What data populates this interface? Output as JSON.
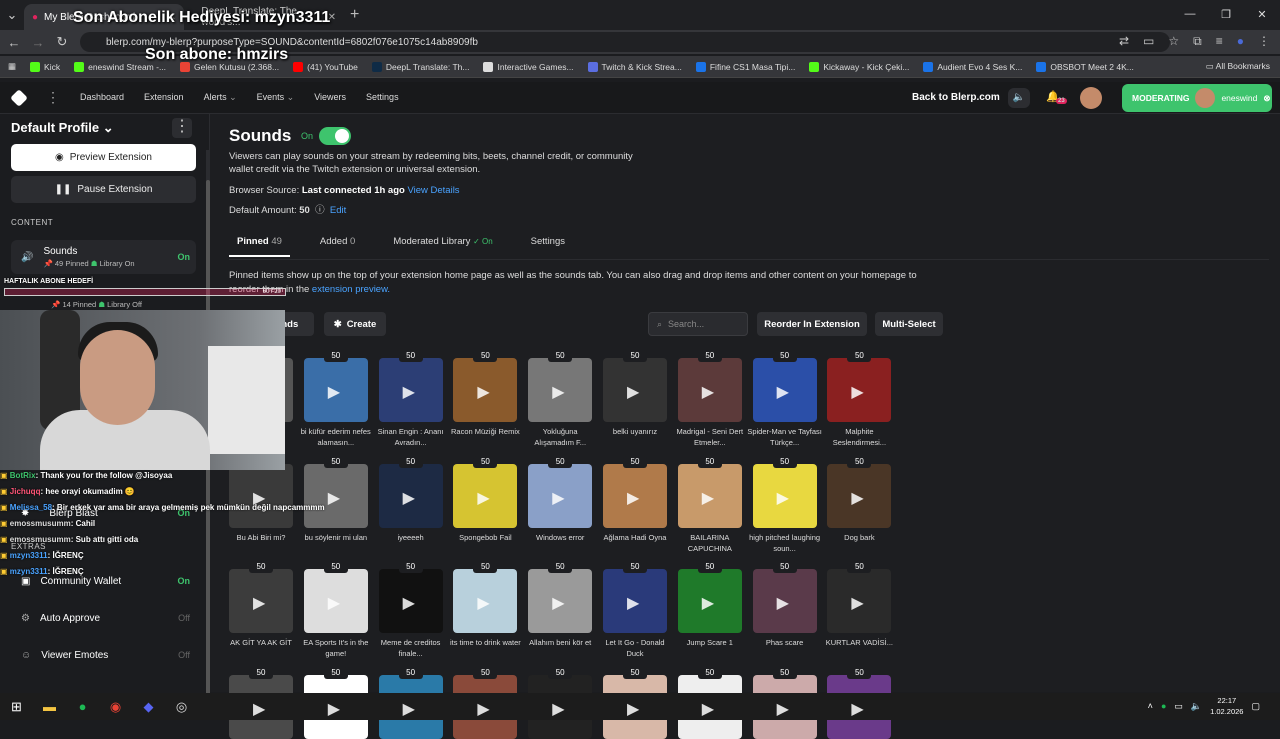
{
  "browser": {
    "tabs": [
      {
        "label": "My Blerp Dashboard",
        "active": true
      },
      {
        "label": "DeepL Translate: The world's...",
        "active": false
      }
    ],
    "url": "blerp.com/my-blerp?purposeType=SOUND&contentId=6802f076e1075c14ab8909fb",
    "bookmarks": [
      "Kick",
      "eneswind Stream -...",
      "Gelen Kutusu (2.368...",
      "(41) YouTube",
      "DeepL Translate: Th...",
      "Interactive Games...",
      "Twitch & Kick Strea...",
      "Fifine CS1 Masa Tipi...",
      "Kickaway - Kick Çeki...",
      "Audient Evo 4 Ses K...",
      "OBSBOT Meet 2 4K..."
    ],
    "bookmarks_right": "All Bookmarks"
  },
  "overlay": {
    "line1": "Son Abonelik Hediyesi: mzyn3311",
    "line2": "Son abone: hmzirs",
    "goal_title": "HAFTALIK ABONE HEDEFİ",
    "goal_value": "60 / 20",
    "chat": [
      {
        "user": "BotRix",
        "msg": ": Thank you for the follow @Jisoyaa",
        "color": "#3ec46d"
      },
      {
        "user": "Jichuqq",
        "msg": ": hee orayi okumadim 😊",
        "color": "#ff5577"
      },
      {
        "user": "Melissa_58",
        "msg": ": Bir erkek var ama bir araya gelmemiş pek mümkün değil napcammmm",
        "color": "#4aa3ff"
      },
      {
        "user": "emossmusumm",
        "msg": ": Cahil",
        "color": "#ddd"
      },
      {
        "user": "emossmusumm",
        "msg": ": Sub attı gitti oda",
        "color": "#ddd"
      },
      {
        "user": "mzyn3311",
        "msg": ": İĞRENÇ",
        "color": "#4aa3ff"
      },
      {
        "user": "mzyn3311",
        "msg": ": İĞRENÇ",
        "color": "#4aa3ff"
      }
    ]
  },
  "nav": {
    "links": [
      "Dashboard",
      "Extension",
      "Alerts",
      "Events",
      "Viewers",
      "Settings"
    ],
    "back": "Back to Blerp.com",
    "notif_count": "23",
    "moderating": "MODERATING",
    "mod_user": "eneswind"
  },
  "sidebar": {
    "profile": "Default Profile",
    "preview": "Preview Extension",
    "pause": "Pause Extension",
    "content_label": "CONTENT",
    "sounds": {
      "label": "Sounds",
      "sub1": "49 Pinned",
      "sub2": "Library On",
      "status": "On"
    },
    "second": {
      "sub1": "14 Pinned",
      "sub2": "Library Off"
    },
    "blast": {
      "label": "Blerp Blast",
      "status": "On"
    },
    "extras_label": "EXTRAS",
    "community": {
      "label": "Community Wallet",
      "status": "On"
    },
    "auto": {
      "label": "Auto Approve",
      "status": "Off"
    },
    "emotes": {
      "label": "Viewer Emotes",
      "status": "Off"
    }
  },
  "main": {
    "title": "Sounds",
    "on_label": "On",
    "desc": "Viewers can play sounds on your stream by redeeming bits, beets, channel credit, or community wallet credit via the Twitch extension or universal extension.",
    "browser_source_label": "Browser Source:",
    "browser_source_value": "Last connected 1h ago",
    "view_details": "View Details",
    "default_amount_label": "Default Amount:",
    "default_amount_value": "50",
    "edit": "Edit",
    "tabs": [
      {
        "label": "Pinned",
        "count": "49"
      },
      {
        "label": "Added",
        "count": "0"
      },
      {
        "label": "Moderated Library",
        "count": "✓ On"
      },
      {
        "label": "Settings",
        "count": ""
      }
    ],
    "pinned_desc": "Pinned items show up on the top of your extension home page as well as the sounds tab. You can also drag and drop items and other content on your homepage to reorder them in the",
    "pinned_link": "extension preview.",
    "add_sounds": "ounds",
    "create": "Create",
    "search_placeholder": "Search...",
    "reorder": "Reorder In Extension",
    "multiselect": "Multi-Select"
  },
  "sounds": [
    {
      "label": "",
      "price": "50",
      "color": "#555"
    },
    {
      "label": "bi küfür ederim nefes alamasın...",
      "price": "50",
      "color": "#3a6ea8"
    },
    {
      "label": "Sinan Engin : Ananı Avradın...",
      "price": "50",
      "color": "#2c3e75"
    },
    {
      "label": "Racon Müziği Remix",
      "price": "50",
      "color": "#8a5a2c"
    },
    {
      "label": "Yokluğuna Alışamadım F...",
      "price": "50",
      "color": "#777"
    },
    {
      "label": "belki uyanırız",
      "price": "50",
      "color": "#333"
    },
    {
      "label": "Madrigal - Seni Dert Etmeler...",
      "price": "50",
      "color": "#5c3a3a"
    },
    {
      "label": "Spider-Man ve Tayfası Türkçe...",
      "price": "50",
      "color": "#2b4fa8"
    },
    {
      "label": "Malphite Seslendirmesi...",
      "price": "50",
      "color": "#8a2020"
    },
    {
      "label": "Bu Abi Biri mi?",
      "price": "50",
      "color": "#3a3a3a"
    },
    {
      "label": "bu söylenir mi ulan",
      "price": "50",
      "color": "#6a6a6a"
    },
    {
      "label": "iyeeeeh",
      "price": "50",
      "color": "#1d2a44"
    },
    {
      "label": "Spongebob Fail",
      "price": "50",
      "color": "#d6c431"
    },
    {
      "label": "Windows error",
      "price": "50",
      "color": "#8aa0c8"
    },
    {
      "label": "Ağlama Hadi Oyna",
      "price": "50",
      "color": "#b07a4a"
    },
    {
      "label": "BAILARINA CAPUCHINA",
      "price": "50",
      "color": "#c89a6a"
    },
    {
      "label": "high pitched laughing soun...",
      "price": "50",
      "color": "#e8d840"
    },
    {
      "label": "Dog bark",
      "price": "50",
      "color": "#4a3626"
    },
    {
      "label": "AK GİT YA AK GİT",
      "price": "50",
      "color": "#3c3c3c"
    },
    {
      "label": "EA Sports It's in the game!",
      "price": "50",
      "color": "#dddddd"
    },
    {
      "label": "Meme de creditos finale...",
      "price": "50",
      "color": "#111"
    },
    {
      "label": "its time to drink water",
      "price": "50",
      "color": "#b8d0dc"
    },
    {
      "label": "Allahım beni kör et",
      "price": "50",
      "color": "#9a9a9a"
    },
    {
      "label": "Let It Go - Donald Duck",
      "price": "50",
      "color": "#2a3a7a"
    },
    {
      "label": "Jump Scare 1",
      "price": "50",
      "color": "#1f7a2a"
    },
    {
      "label": "Phas scare",
      "price": "50",
      "color": "#5a3a4a"
    },
    {
      "label": "KURTLAR VADİSİ...",
      "price": "50",
      "color": "#2a2a2a"
    },
    {
      "label": "",
      "price": "50",
      "color": "#4a4a4a"
    },
    {
      "label": "",
      "price": "50",
      "color": "#fff"
    },
    {
      "label": "",
      "price": "50",
      "color": "#2a7aa8"
    },
    {
      "label": "",
      "price": "50",
      "color": "#8a4a3a"
    },
    {
      "label": "",
      "price": "50",
      "color": "#222"
    },
    {
      "label": "",
      "price": "50",
      "color": "#d8b8a8"
    },
    {
      "label": "",
      "price": "50",
      "color": "#eee"
    },
    {
      "label": "",
      "price": "50",
      "color": "#caa"
    },
    {
      "label": "",
      "price": "50",
      "color": "#6a3a8a"
    }
  ],
  "taskbar": {
    "time": "22:17",
    "date": "1.02.2026"
  }
}
